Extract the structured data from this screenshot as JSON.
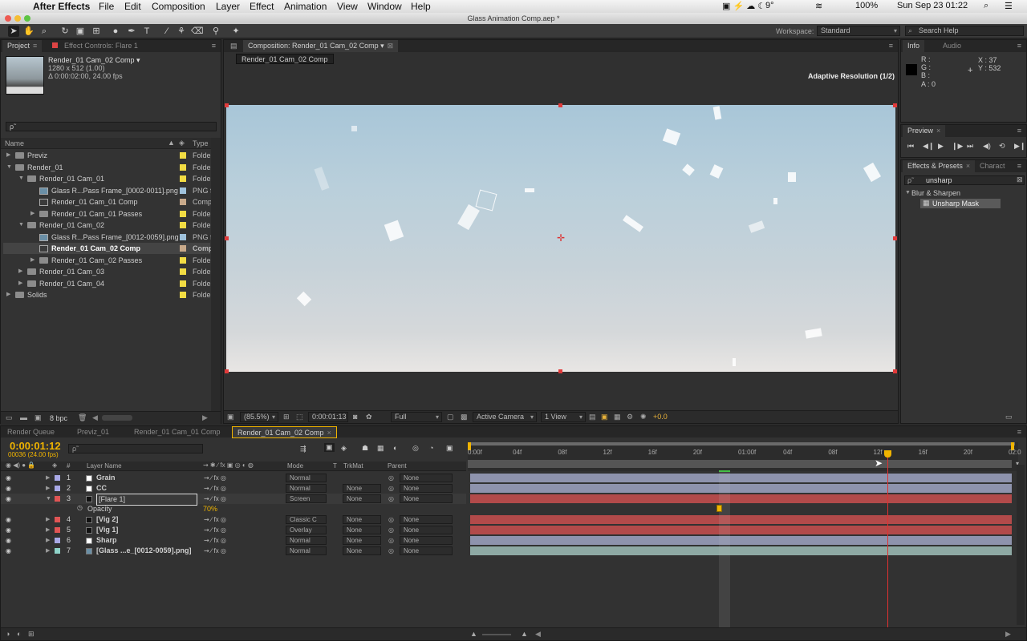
{
  "menubar": {
    "app": "After Effects",
    "items": [
      "File",
      "Edit",
      "Composition",
      "Layer",
      "Effect",
      "Animation",
      "View",
      "Window",
      "Help"
    ],
    "status": {
      "temp": "9°",
      "battery": "100%",
      "datetime": "Sun Sep 23  01:22"
    }
  },
  "window": {
    "title": "Glass Animation Comp.aep *"
  },
  "toolbar": {
    "workspace_label": "Workspace:",
    "workspace_value": "Standard",
    "search_placeholder": "Search Help"
  },
  "project": {
    "tabs": [
      "Project",
      "Effect Controls: Flare 1"
    ],
    "comp_name": "Render_01 Cam_02 Comp ▾",
    "comp_size": "1280 x 512 (1.00)",
    "comp_duration": "Δ 0:00:02:00, 24.00 fps",
    "search_value": "ρ˜",
    "col_name": "Name",
    "col_type": "Type",
    "rows": [
      {
        "name": "Previz",
        "type": "Folde"
      },
      {
        "name": "Render_01",
        "type": "Folde"
      },
      {
        "name": "Render_01 Cam_01",
        "type": "Folde"
      },
      {
        "name": "Glass R...Pass Frame_[0002-0011].png",
        "type": "PNG f"
      },
      {
        "name": "Render_01 Cam_01 Comp",
        "type": "Comp"
      },
      {
        "name": "Render_01 Cam_01 Passes",
        "type": "Folde"
      },
      {
        "name": "Render_01 Cam_02",
        "type": "Folde"
      },
      {
        "name": "Glass R...Pass Frame_[0012-0059].png",
        "type": "PNG f"
      },
      {
        "name": "Render_01 Cam_02 Comp",
        "type": "Comp"
      },
      {
        "name": "Render_01 Cam_02 Passes",
        "type": "Folde"
      },
      {
        "name": "Render_01 Cam_03",
        "type": "Folde"
      },
      {
        "name": "Render_01 Cam_04",
        "type": "Folde"
      },
      {
        "name": "Solids",
        "type": "Folde"
      }
    ],
    "bpc": "8 bpc"
  },
  "composition": {
    "tab": "Composition: Render_01 Cam_02 Comp",
    "subtab": "Render_01 Cam_02 Comp",
    "adaptive": "Adaptive Resolution (1/2)",
    "zoom": "(85.5%)",
    "timecode": "0:00:01:13",
    "resolution": "Full",
    "camera": "Active Camera",
    "views": "1 View",
    "exposure": "+0.0"
  },
  "info": {
    "tabs": [
      "Info",
      "Audio"
    ],
    "r": "R :",
    "g": "G :",
    "b": "B :",
    "a": "A : 0",
    "x": "X : 37",
    "y": "Y : 532"
  },
  "preview": {
    "tab": "Preview"
  },
  "effects": {
    "tabs": [
      "Effects & Presets",
      "Charact"
    ],
    "search_value": "unsharp",
    "category": "Blur & Sharpen",
    "item": "Unsharp Mask"
  },
  "timeline": {
    "tabs": [
      "Render Queue",
      "Previz_01",
      "Render_01 Cam_01 Comp",
      "Render_01 Cam_02 Comp"
    ],
    "timecode": "0:00:01:12",
    "frame_info": "00036 (24.00 fps)",
    "col_layer_name": "Layer Name",
    "col_mode": "Mode",
    "col_t": "T",
    "col_trkmat": "TrkMat",
    "col_parent": "Parent",
    "ruler": [
      "0:00f",
      "04f",
      "08f",
      "12f",
      "16f",
      "20f",
      "01:00f",
      "04f",
      "08f",
      "12f",
      "16f",
      "20f",
      "02:0"
    ],
    "layers": [
      {
        "num": "1",
        "name": "Grain",
        "mode": "Normal",
        "trkmat": "",
        "parent": "None",
        "color": "#a9a9e6",
        "sq": "#ffffff"
      },
      {
        "num": "2",
        "name": "CC",
        "mode": "Normal",
        "trkmat": "None",
        "parent": "None",
        "color": "#a9a9e6",
        "sq": "#ffffff"
      },
      {
        "num": "3",
        "name": "[Flare 1]",
        "mode": "Screen",
        "trkmat": "None",
        "parent": "None",
        "color": "#e05555",
        "sq": "#111111"
      },
      {
        "num": "4",
        "name": "[Vig 2]",
        "mode": "Classic C",
        "trkmat": "None",
        "parent": "None",
        "color": "#e05555",
        "sq": "#111111"
      },
      {
        "num": "5",
        "name": "[Vig 1]",
        "mode": "Overlay",
        "trkmat": "None",
        "parent": "None",
        "color": "#e05555",
        "sq": "#111111"
      },
      {
        "num": "6",
        "name": "Sharp",
        "mode": "Normal",
        "trkmat": "None",
        "parent": "None",
        "color": "#a9a9e6",
        "sq": "#ffffff"
      },
      {
        "num": "7",
        "name": "[Glass ...e_[0012-0059].png]",
        "mode": "Normal",
        "trkmat": "None",
        "parent": "None",
        "color": "#8fd3c9",
        "sq": "#6a8fa6"
      }
    ],
    "opacity_label": "Opacity",
    "opacity_value": "70%"
  },
  "colors": {
    "accent": "#f0b400",
    "layer_red": "#b24a4a",
    "layer_blue": "#8e93ad",
    "layer_teal": "#8ea9a4",
    "playhead": "#e03030"
  }
}
